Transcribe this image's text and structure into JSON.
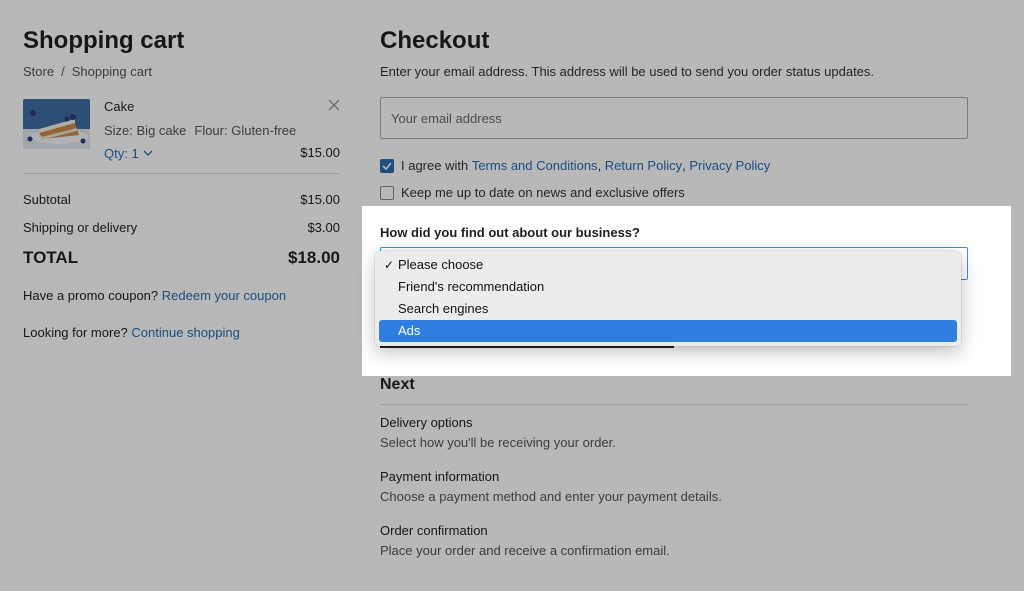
{
  "cart": {
    "title": "Shopping cart",
    "breadcrumb": [
      "Store",
      "Shopping cart"
    ],
    "item": {
      "name": "Cake",
      "size": "Size: Big cake",
      "flour": "Flour: Gluten-free",
      "qty": "Qty: 1",
      "price": "$15.00",
      "thumbnail_icon": "cake-slice-photo"
    },
    "subtotal": {
      "label": "Subtotal",
      "value": "$15.00"
    },
    "shipping": {
      "label": "Shipping or delivery",
      "value": "$3.00"
    },
    "total": {
      "label": "TOTAL",
      "value": "$18.00"
    },
    "promo": {
      "text": "Have a promo coupon?",
      "link": "Redeem your coupon"
    },
    "more": {
      "text": "Looking for more?",
      "link": "Continue shopping"
    }
  },
  "checkout": {
    "title": "Checkout",
    "intro": "Enter your email address. This address will be used to send you order status updates.",
    "email_placeholder": "Your email address",
    "agree": {
      "prefix": "I agree with ",
      "terms": "Terms and Conditions",
      "sep1": ", ",
      "returns": "Return Policy",
      "sep2": ", ",
      "privacy": "Privacy Policy",
      "checked": true
    },
    "newsletter": {
      "label": "Keep me up to date on news and exclusive offers",
      "checked": false
    },
    "question": "How did you find out about our business?",
    "dropdown": {
      "options": [
        "Please choose",
        "Friend's recommendation",
        "Search engines",
        "Ads"
      ],
      "checked_index": 0,
      "highlighted_index": 3
    }
  },
  "next": {
    "title": "Next",
    "steps": [
      {
        "title": "Delivery options",
        "desc": "Select how you'll be receiving your order."
      },
      {
        "title": "Payment information",
        "desc": "Choose a payment method and enter your payment details."
      },
      {
        "title": "Order confirmation",
        "desc": "Place your order and receive a confirmation email."
      }
    ]
  },
  "colors": {
    "link": "#2a6db0",
    "highlight": "#2f7fe0",
    "focus_border": "#3b8be6"
  }
}
